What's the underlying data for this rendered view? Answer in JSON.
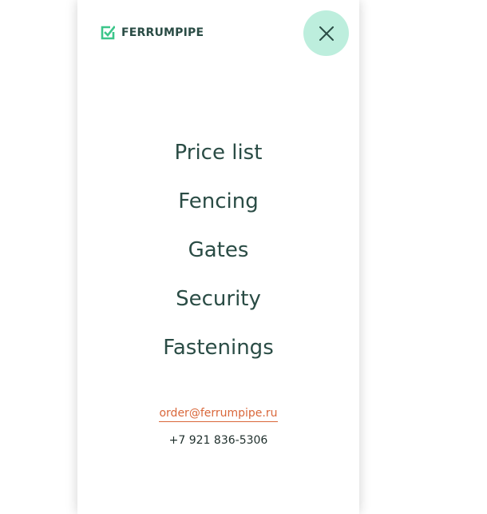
{
  "header": {
    "logo_text": "FERRUMPIPE",
    "logo_icon": "check-square-icon",
    "close_icon": "close-icon"
  },
  "menu": {
    "items": [
      {
        "label": "Price list"
      },
      {
        "label": "Fencing"
      },
      {
        "label": "Gates"
      },
      {
        "label": "Security"
      },
      {
        "label": "Fastenings"
      }
    ]
  },
  "contacts": {
    "email": "order@ferrumpipe.ru",
    "phone": "+7 921 836-5306"
  },
  "colors": {
    "brand_text": "#2a4c45",
    "accent_green": "#3cc68a",
    "close_bg": "#bdeedd",
    "email": "#d9673a"
  }
}
